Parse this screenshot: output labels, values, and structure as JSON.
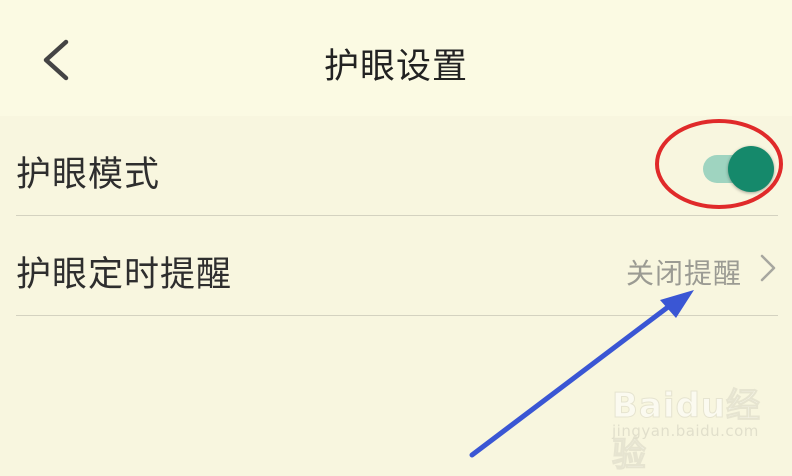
{
  "header": {
    "title": "护眼设置",
    "back_icon": "chevron-left-icon"
  },
  "settings": [
    {
      "label": "护眼模式",
      "control": "toggle",
      "enabled": true
    },
    {
      "label": "护眼定时提醒",
      "value": "关闭提醒",
      "trailing_icon": "chevron-right-icon"
    }
  ],
  "colors": {
    "background": "#f8f6df",
    "header_background": "#fbfae3",
    "toggle_track": "#9fd4c0",
    "toggle_knob": "#15896b",
    "annotation_circle": "#e02a2a",
    "annotation_arrow": "#3a56d4"
  },
  "watermark": {
    "brand": "Baidu经验",
    "url": "jingyan.baidu.com"
  }
}
